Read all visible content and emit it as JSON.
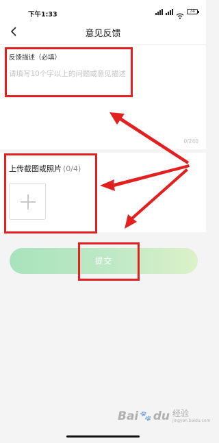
{
  "status_bar": {
    "time": "下午1:33",
    "battery": "74"
  },
  "header": {
    "title": "意见反馈",
    "back_icon": "chevron-left-icon"
  },
  "feedback": {
    "label": "反馈描述（必填）",
    "placeholder": "请填写10个字以上的问题或意见描述",
    "value": "",
    "char_count": "0/240"
  },
  "upload": {
    "label": "上传截图或照片",
    "count": "(0/4)",
    "add_icon": "plus-icon"
  },
  "submit": {
    "label": "提交"
  },
  "watermark": {
    "brand_left": "Bai",
    "brand_right": "du",
    "text": "经验",
    "subtext": "jingyan.baidu.com"
  },
  "colors": {
    "background": "#f4f4f5",
    "annotation_red": "#e32020",
    "submit_gradient_start": "#a8e3bd",
    "submit_gradient_end": "#dcf1c9"
  }
}
